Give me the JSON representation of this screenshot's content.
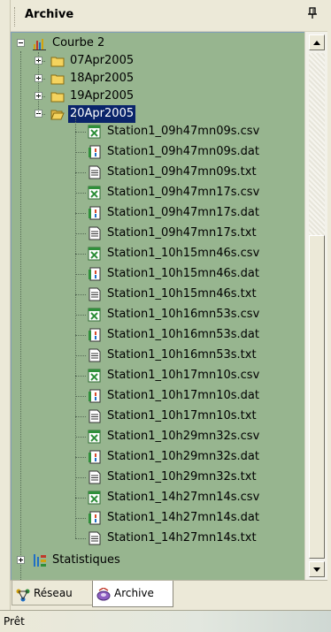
{
  "panel": {
    "title": "Archive",
    "pin_glyph": "ᵖ"
  },
  "tree": {
    "root_label": "Courbe 2",
    "folders": [
      {
        "label": "07Apr2005",
        "expanded": false
      },
      {
        "label": "18Apr2005",
        "expanded": false
      },
      {
        "label": "19Apr2005",
        "expanded": false
      },
      {
        "label": "20Apr2005",
        "expanded": true,
        "selected": true
      }
    ],
    "files": [
      {
        "label": "Station1_09h47mn09s.csv",
        "type": "csv"
      },
      {
        "label": "Station1_09h47mn09s.dat",
        "type": "dat"
      },
      {
        "label": "Station1_09h47mn09s.txt",
        "type": "txt"
      },
      {
        "label": "Station1_09h47mn17s.csv",
        "type": "csv"
      },
      {
        "label": "Station1_09h47mn17s.dat",
        "type": "dat"
      },
      {
        "label": "Station1_09h47mn17s.txt",
        "type": "txt"
      },
      {
        "label": "Station1_10h15mn46s.csv",
        "type": "csv"
      },
      {
        "label": "Station1_10h15mn46s.dat",
        "type": "dat"
      },
      {
        "label": "Station1_10h15mn46s.txt",
        "type": "txt"
      },
      {
        "label": "Station1_10h16mn53s.csv",
        "type": "csv"
      },
      {
        "label": "Station1_10h16mn53s.dat",
        "type": "dat"
      },
      {
        "label": "Station1_10h16mn53s.txt",
        "type": "txt"
      },
      {
        "label": "Station1_10h17mn10s.csv",
        "type": "csv"
      },
      {
        "label": "Station1_10h17mn10s.dat",
        "type": "dat"
      },
      {
        "label": "Station1_10h17mn10s.txt",
        "type": "txt"
      },
      {
        "label": "Station1_10h29mn32s.csv",
        "type": "csv"
      },
      {
        "label": "Station1_10h29mn32s.dat",
        "type": "dat"
      },
      {
        "label": "Station1_10h29mn32s.txt",
        "type": "txt"
      },
      {
        "label": "Station1_14h27mn14s.csv",
        "type": "csv"
      },
      {
        "label": "Station1_14h27mn14s.dat",
        "type": "dat"
      },
      {
        "label": "Station1_14h27mn14s.txt",
        "type": "txt"
      }
    ],
    "statistics_label": "Statistiques"
  },
  "tabs": [
    {
      "label": "Réseau",
      "icon": "network-icon",
      "active": false
    },
    {
      "label": "Archive",
      "icon": "archive-icon",
      "active": true
    }
  ],
  "status": {
    "text": "Prêt"
  },
  "colors": {
    "tree_bg": "#97b58f",
    "selection": "#0a246a",
    "folder": "#f4d35e",
    "csv": "#2f8f3a",
    "dat": "#d64a2a"
  }
}
